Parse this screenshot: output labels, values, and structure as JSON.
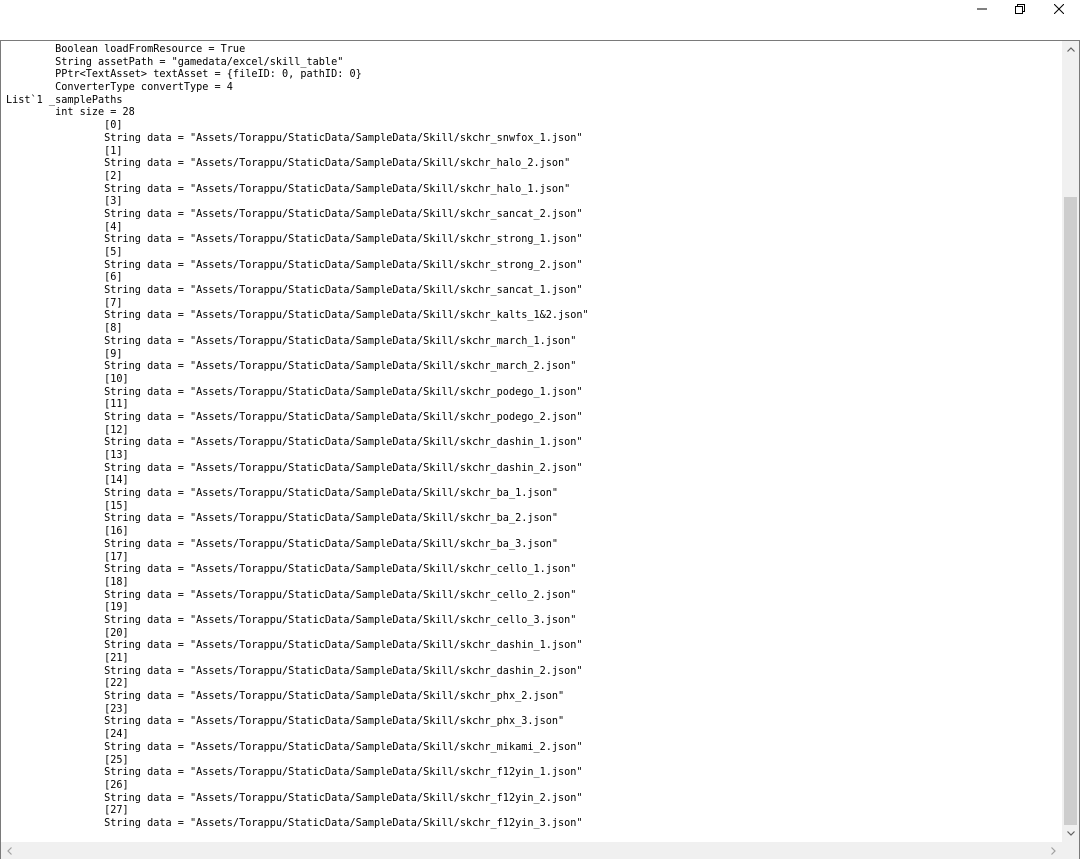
{
  "window": {
    "controls": {
      "minimize_icon": "minimize-icon",
      "maximize_icon": "restore-icon",
      "close_icon": "close-icon"
    }
  },
  "text_lines": [
    "        Boolean loadFromResource = True",
    "        String assetPath = \"gamedata/excel/skill_table\"",
    "        PPtr<TextAsset> textAsset = {fileID: 0, pathID: 0}",
    "        ConverterType convertType = 4",
    "List`1 _samplePaths",
    "        int size = 28",
    "                [0]",
    "                String data = \"Assets/Torappu/StaticData/SampleData/Skill/skchr_snwfox_1.json\"",
    "                [1]",
    "                String data = \"Assets/Torappu/StaticData/SampleData/Skill/skchr_halo_2.json\"",
    "                [2]",
    "                String data = \"Assets/Torappu/StaticData/SampleData/Skill/skchr_halo_1.json\"",
    "                [3]",
    "                String data = \"Assets/Torappu/StaticData/SampleData/Skill/skchr_sancat_2.json\"",
    "                [4]",
    "                String data = \"Assets/Torappu/StaticData/SampleData/Skill/skchr_strong_1.json\"",
    "                [5]",
    "                String data = \"Assets/Torappu/StaticData/SampleData/Skill/skchr_strong_2.json\"",
    "                [6]",
    "                String data = \"Assets/Torappu/StaticData/SampleData/Skill/skchr_sancat_1.json\"",
    "                [7]",
    "                String data = \"Assets/Torappu/StaticData/SampleData/Skill/skchr_kalts_1&2.json\"",
    "                [8]",
    "                String data = \"Assets/Torappu/StaticData/SampleData/Skill/skchr_march_1.json\"",
    "                [9]",
    "                String data = \"Assets/Torappu/StaticData/SampleData/Skill/skchr_march_2.json\"",
    "                [10]",
    "                String data = \"Assets/Torappu/StaticData/SampleData/Skill/skchr_podego_1.json\"",
    "                [11]",
    "                String data = \"Assets/Torappu/StaticData/SampleData/Skill/skchr_podego_2.json\"",
    "                [12]",
    "                String data = \"Assets/Torappu/StaticData/SampleData/Skill/skchr_dashin_1.json\"",
    "                [13]",
    "                String data = \"Assets/Torappu/StaticData/SampleData/Skill/skchr_dashin_2.json\"",
    "                [14]",
    "                String data = \"Assets/Torappu/StaticData/SampleData/Skill/skchr_ba_1.json\"",
    "                [15]",
    "                String data = \"Assets/Torappu/StaticData/SampleData/Skill/skchr_ba_2.json\"",
    "                [16]",
    "                String data = \"Assets/Torappu/StaticData/SampleData/Skill/skchr_ba_3.json\"",
    "                [17]",
    "                String data = \"Assets/Torappu/StaticData/SampleData/Skill/skchr_cello_1.json\"",
    "                [18]",
    "                String data = \"Assets/Torappu/StaticData/SampleData/Skill/skchr_cello_2.json\"",
    "                [19]",
    "                String data = \"Assets/Torappu/StaticData/SampleData/Skill/skchr_cello_3.json\"",
    "                [20]",
    "                String data = \"Assets/Torappu/StaticData/SampleData/Skill/skchr_dashin_1.json\"",
    "                [21]",
    "                String data = \"Assets/Torappu/StaticData/SampleData/Skill/skchr_dashin_2.json\"",
    "                [22]",
    "                String data = \"Assets/Torappu/StaticData/SampleData/Skill/skchr_phx_2.json\"",
    "                [23]",
    "                String data = \"Assets/Torappu/StaticData/SampleData/Skill/skchr_phx_3.json\"",
    "                [24]",
    "                String data = \"Assets/Torappu/StaticData/SampleData/Skill/skchr_mikami_2.json\"",
    "                [25]",
    "                String data = \"Assets/Torappu/StaticData/SampleData/Skill/skchr_f12yin_1.json\"",
    "                [26]",
    "                String data = \"Assets/Torappu/StaticData/SampleData/Skill/skchr_f12yin_2.json\"",
    "                [27]",
    "                String data = \"Assets/Torappu/StaticData/SampleData/Skill/skchr_f12yin_3.json\""
  ],
  "scrollbar": {
    "vertical_position": 0.97,
    "up_icon": "chevron-up-icon",
    "down_icon": "chevron-down-icon",
    "left_icon": "chevron-left-icon",
    "right_icon": "chevron-right-icon"
  }
}
